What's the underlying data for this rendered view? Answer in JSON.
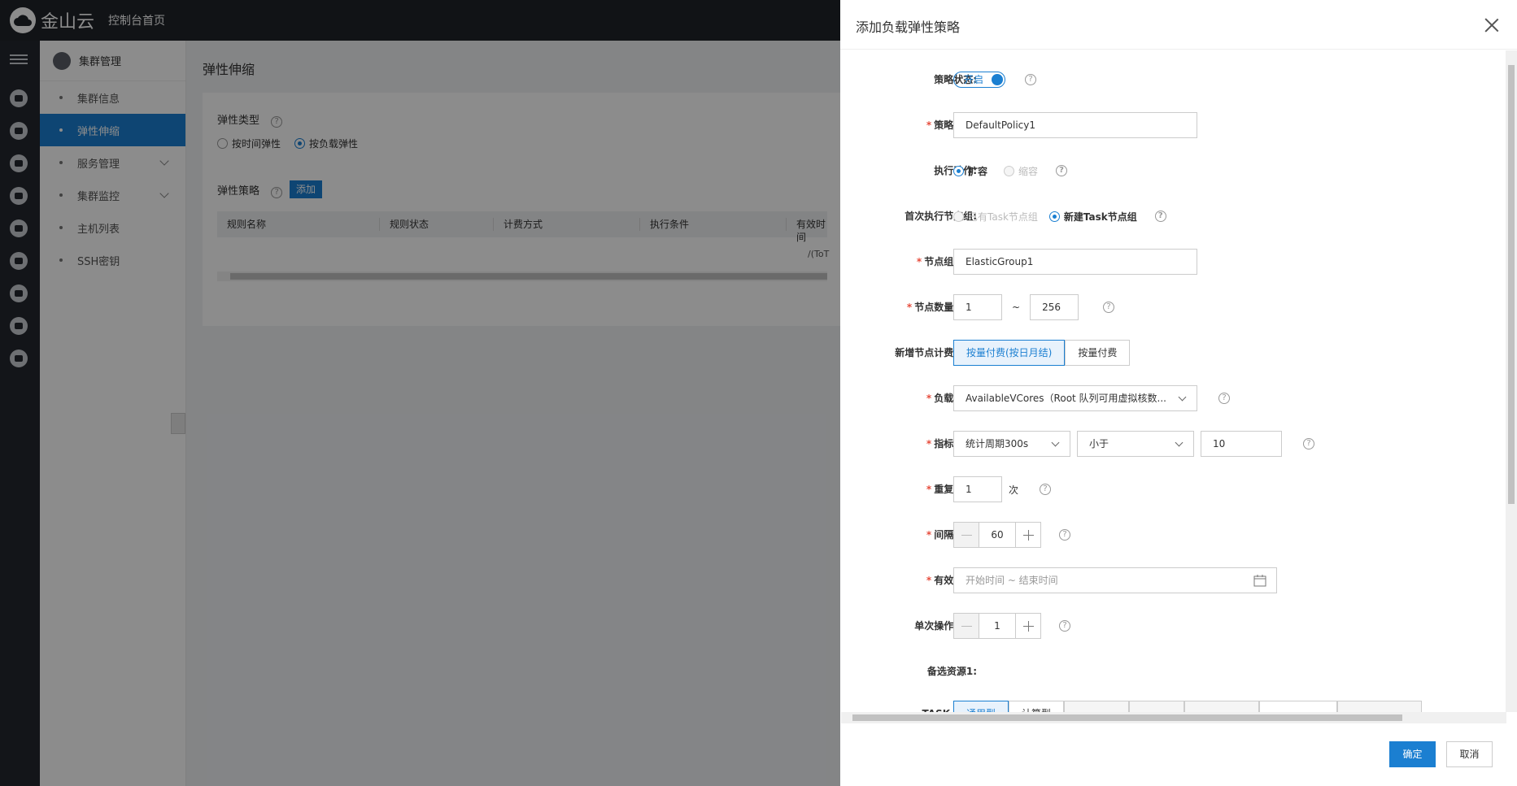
{
  "app": {
    "logo_text": "金山云",
    "console_home": "控制台首页"
  },
  "sidebar": {
    "header": "集群管理",
    "items": [
      {
        "label": "集群信息"
      },
      {
        "label": "弹性伸缩"
      },
      {
        "label": "服务管理"
      },
      {
        "label": "集群监控"
      },
      {
        "label": "主机列表"
      },
      {
        "label": "SSH密钥"
      }
    ]
  },
  "main": {
    "title": "弹性伸缩",
    "type_label": "弹性类型",
    "type_options": [
      "按时间弹性",
      "按负载弹性"
    ],
    "policy_label": "弹性策略",
    "add_button": "添加",
    "columns": [
      "规则名称",
      "规则状态",
      "计费方式",
      "执行条件",
      "有效时间"
    ],
    "table_hint": "/(ToT"
  },
  "drawer": {
    "title": "添加负载弹性策略",
    "fields": {
      "status": {
        "label": "策略状态:",
        "value": "开启"
      },
      "name": {
        "label": "策略名称:",
        "value": "DefaultPolicy1"
      },
      "action": {
        "label": "执行动作:",
        "options": [
          "扩容",
          "缩容"
        ]
      },
      "first_group": {
        "label": "首次执行节点组:",
        "options": [
          "已有Task节点组",
          "新建Task节点组"
        ]
      },
      "group_alias": {
        "label": "节点组别名:",
        "value": "ElasticGroup1"
      },
      "node_range": {
        "label": "节点数量范围:",
        "min": "1",
        "sep": "~",
        "max": "256"
      },
      "billing": {
        "label": "新增节点计费方式:",
        "options": [
          "按量付费(按日月结)",
          "按量付费"
        ]
      },
      "metric": {
        "label": "负载指标:",
        "value": "AvailableVCores（Root 队列可用虚拟核数..."
      },
      "threshold": {
        "label": "指标阈值:",
        "period": "统计周期300s",
        "compare": "小于",
        "value": "10"
      },
      "repeat": {
        "label": "重复次数:",
        "value": "1",
        "unit": "次"
      },
      "interval": {
        "label": "间隔时间:",
        "value": "60"
      },
      "valid_time": {
        "label": "有效时间:",
        "placeholder": "开始时间 ~ 结束时间"
      },
      "per_op": {
        "label": "单次操作台数:",
        "value": "1"
      },
      "backup": {
        "label": "备选资源1:"
      },
      "task_type": {
        "label": "TASK 类型:",
        "options": [
          "通用型",
          "计算型",
          "",
          "",
          "",
          "",
          ""
        ]
      }
    },
    "ok_button": "确定",
    "cancel_button": "取消",
    "help_glyph": "?"
  }
}
